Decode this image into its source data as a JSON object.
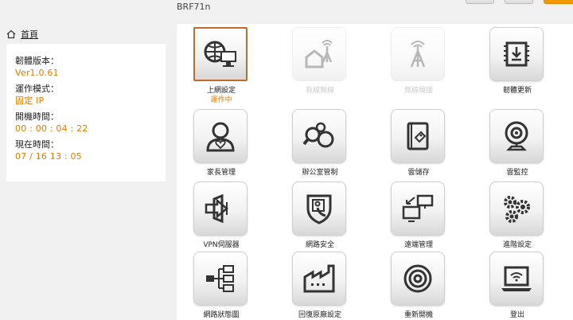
{
  "header": {
    "model": "BRF71n"
  },
  "nav": {
    "home": "首頁"
  },
  "info": {
    "firmware_label": "韌體版本：",
    "firmware_value": "Ver1.0.61",
    "mode_label": "運作模式：",
    "mode_value": "固定 IP",
    "uptime_label": "開機時間：",
    "uptime_value": "00 : 00 : 04 : 22",
    "time_label": "現在時間：",
    "time_value": "07 / 16  13 : 05"
  },
  "menu": {
    "internet": {
      "label": "上網設定",
      "status": "運作中",
      "icon": "globe-monitor-icon"
    },
    "wireless": {
      "label": "有線無線",
      "icon": "wifi-house-icon"
    },
    "repeater": {
      "label": "無線橋接",
      "icon": "antenna-icon"
    },
    "firmware": {
      "label": "韌體更新",
      "icon": "chip-download-icon"
    },
    "family": {
      "label": "家長管理",
      "icon": "person-heart-icon"
    },
    "office": {
      "label": "辦公室管制",
      "icon": "magnifier-circles-icon"
    },
    "storage": {
      "label": "雲儲存",
      "icon": "notebook-tag-icon"
    },
    "camera": {
      "label": "雲監控",
      "icon": "webcam-icon"
    },
    "vpn": {
      "label": "VPN伺服器",
      "icon": "vpn-arrow-icon"
    },
    "security": {
      "label": "網路安全",
      "icon": "shield-person-icon"
    },
    "remote": {
      "label": "遠端管理",
      "icon": "remote-monitors-icon"
    },
    "advanced": {
      "label": "進階設定",
      "icon": "gears-icon"
    },
    "topology": {
      "label": "網路狀態圖",
      "icon": "network-tree-icon"
    },
    "factory": {
      "label": "回復原廠設定",
      "icon": "factory-icon"
    },
    "reboot": {
      "label": "重新開機",
      "icon": "reboot-rings-icon"
    },
    "logout": {
      "label": "登出",
      "icon": "laptop-wifi-icon"
    }
  },
  "colors": {
    "accent": "#e07a00",
    "active_border": "#c26a2a",
    "panel": "#ffffff",
    "background": "#f0f0f0"
  }
}
